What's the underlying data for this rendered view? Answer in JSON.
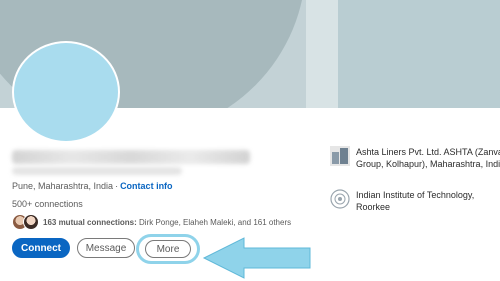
{
  "profile": {
    "location": "Pune, Maharashtra, India",
    "contact_info": "Contact info",
    "connections": "500+ connections",
    "mutual": {
      "count_label": "163 mutual connections:",
      "names": "Dirk Ponge, Elaheh Maleki, and 161 others"
    }
  },
  "actions": {
    "connect": "Connect",
    "message": "Message",
    "more": "More"
  },
  "organizations": [
    {
      "name": "Ashta Liners Pvt. Ltd. ASHTA (Zanvar Group, Kolhapur), Maharashtra, India",
      "icon": "company-logo-icon"
    },
    {
      "name": "Indian Institute of Technology, Roorkee",
      "icon": "university-logo-icon"
    }
  ],
  "colors": {
    "accent": "#0a66c2",
    "highlight": "#8fd3ea",
    "avatar": "#a9dcee",
    "banner": "#a7b9bd"
  }
}
